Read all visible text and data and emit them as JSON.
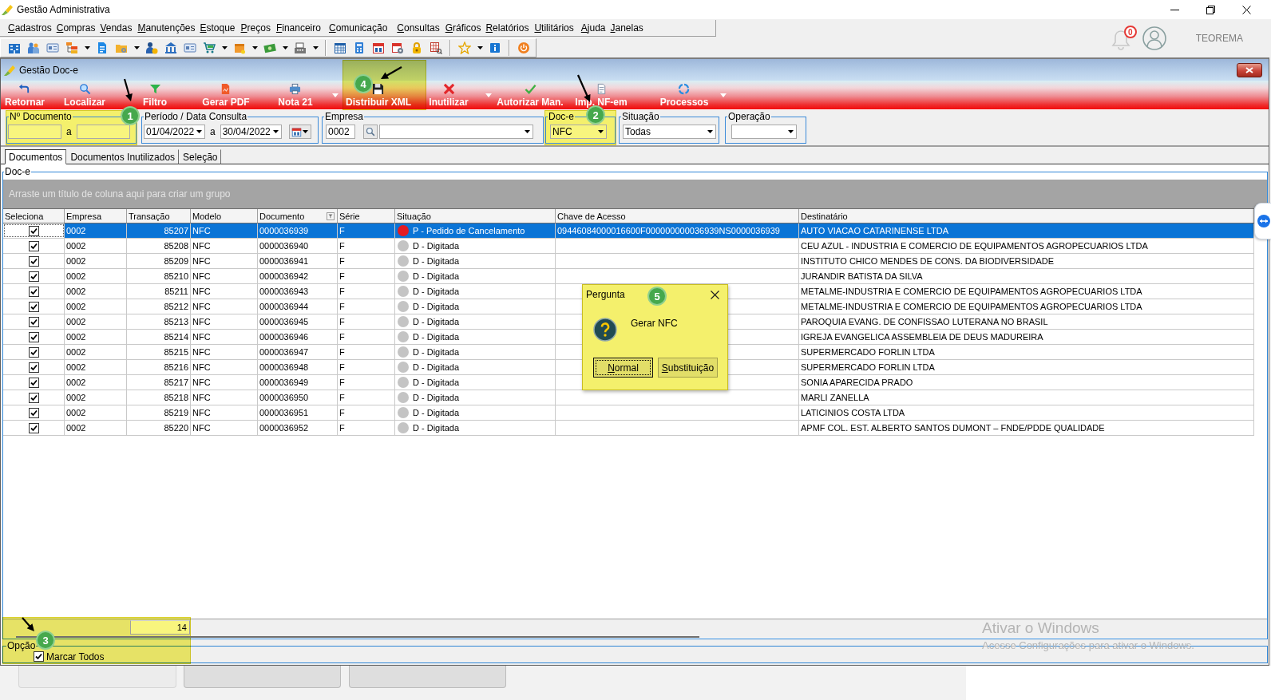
{
  "window": {
    "title": "Gestão Administrativa"
  },
  "menu": [
    "Cadastros",
    "Compras",
    "Vendas",
    "Manutenções",
    "Estoque",
    "Preços",
    "Financeiro",
    "Comunicação",
    "Consultas",
    "Gráficos",
    "Relatórios",
    "Utilitários",
    "Ajuda",
    "Janelas"
  ],
  "account": {
    "notifications": "0",
    "user": "TEOREMA"
  },
  "doc_window": {
    "title": "Gestão Doc-e",
    "actions": [
      {
        "label": "Retornar",
        "menu": false
      },
      {
        "label": "Localizar",
        "menu": false
      },
      {
        "label": "Filtro",
        "menu": false
      },
      {
        "label": "Gerar PDF",
        "menu": false
      },
      {
        "label": "Nota 21",
        "menu": true
      },
      {
        "label": "Distribuir XML",
        "menu": false
      },
      {
        "label": "Inutilizar",
        "menu": true
      },
      {
        "label": "Autorizar Man.",
        "menu": false
      },
      {
        "label": "Imp. NF-em",
        "menu": false
      },
      {
        "label": "Processos",
        "menu": true
      }
    ],
    "filters": {
      "document_number": {
        "label": "Nº Documento",
        "separator": "a"
      },
      "period": {
        "label": "Período / Data Consulta",
        "from": "01/04/2022",
        "separator": "a",
        "to": "30/04/2022"
      },
      "company": {
        "label": "Empresa",
        "code": "0002"
      },
      "doc_type": {
        "label": "Doc-e",
        "value": "NFC"
      },
      "status": {
        "label": "Situação",
        "value": "Todas"
      },
      "operation": {
        "label": "Operação"
      }
    },
    "tabs": [
      {
        "label": "Documentos",
        "selected": true
      },
      {
        "label": "Documentos Inutilizados",
        "selected": false
      },
      {
        "label": "Seleção",
        "selected": false
      }
    ],
    "grid": {
      "title": "Doc-e",
      "group_hint": "Arraste um título de coluna aqui para criar um grupo",
      "columns": [
        {
          "label": "Seleciona",
          "filter_button": false
        },
        {
          "label": "Empresa",
          "filter_button": false
        },
        {
          "label": "Transação",
          "filter_button": false
        },
        {
          "label": "Modelo",
          "filter_button": false
        },
        {
          "label": "Documento",
          "filter_button": true
        },
        {
          "label": "Série",
          "filter_button": false
        },
        {
          "label": "Situação",
          "filter_button": false
        },
        {
          "label": "Chave de Acesso",
          "filter_button": false
        },
        {
          "label": "Destinatário",
          "filter_button": false
        }
      ],
      "rows": [
        {
          "selected": true,
          "checked": true,
          "company": "0002",
          "transaction": "85207",
          "model": "NFC",
          "document": "0000036939",
          "series": "F",
          "color": "#e31b23",
          "status": "P - Pedido de Cancelamento",
          "access_key": "09446084000016600F000000000036939NS0000036939",
          "recipient": "AUTO VIACAO CATARINENSE LTDA"
        },
        {
          "selected": false,
          "checked": true,
          "company": "0002",
          "transaction": "85208",
          "model": "NFC",
          "document": "0000036940",
          "series": "F",
          "color": "#c4c4c4",
          "status": "D - Digitada",
          "recipient": "CEU AZUL - INDUSTRIA E COMERCIO DE EQUIPAMENTOS AGROPECUARIOS LTDA"
        },
        {
          "selected": false,
          "checked": true,
          "company": "0002",
          "transaction": "85209",
          "model": "NFC",
          "document": "0000036941",
          "series": "F",
          "color": "#c4c4c4",
          "status": "D - Digitada",
          "recipient": "INSTITUTO CHICO MENDES DE CONS. DA BIODIVERSIDADE"
        },
        {
          "selected": false,
          "checked": true,
          "company": "0002",
          "transaction": "85210",
          "model": "NFC",
          "document": "0000036942",
          "series": "F",
          "color": "#c4c4c4",
          "status": "D - Digitada",
          "recipient": "JURANDIR BATISTA DA SILVA"
        },
        {
          "selected": false,
          "checked": true,
          "company": "0002",
          "transaction": "85211",
          "model": "NFC",
          "document": "0000036943",
          "series": "F",
          "color": "#c4c4c4",
          "status": "D - Digitada",
          "recipient": "METALME-INDUSTRIA E COMERCIO DE EQUIPAMENTOS AGROPECUARIOS LTDA"
        },
        {
          "selected": false,
          "checked": true,
          "company": "0002",
          "transaction": "85212",
          "model": "NFC",
          "document": "0000036944",
          "series": "F",
          "color": "#c4c4c4",
          "status": "D - Digitada",
          "recipient": "METALME-INDUSTRIA E COMERCIO DE EQUIPAMENTOS AGROPECUARIOS LTDA"
        },
        {
          "selected": false,
          "checked": true,
          "company": "0002",
          "transaction": "85213",
          "model": "NFC",
          "document": "0000036945",
          "series": "F",
          "color": "#c4c4c4",
          "status": "D - Digitada",
          "recipient": "PAROQUIA EVANG. DE CONFISSAO LUTERANA NO BRASIL"
        },
        {
          "selected": false,
          "checked": true,
          "company": "0002",
          "transaction": "85214",
          "model": "NFC",
          "document": "0000036946",
          "series": "F",
          "color": "#c4c4c4",
          "status": "D - Digitada",
          "recipient": "IGREJA EVANGELICA ASSEMBLEIA DE DEUS MADUREIRA"
        },
        {
          "selected": false,
          "checked": true,
          "company": "0002",
          "transaction": "85215",
          "model": "NFC",
          "document": "0000036947",
          "series": "F",
          "color": "#c4c4c4",
          "status": "D - Digitada",
          "recipient": "SUPERMERCADO FORLIN LTDA"
        },
        {
          "selected": false,
          "checked": true,
          "company": "0002",
          "transaction": "85216",
          "model": "NFC",
          "document": "0000036948",
          "series": "F",
          "color": "#c4c4c4",
          "status": "D - Digitada",
          "recipient": "SUPERMERCADO FORLIN LTDA"
        },
        {
          "selected": false,
          "checked": true,
          "company": "0002",
          "transaction": "85217",
          "model": "NFC",
          "document": "0000036949",
          "series": "F",
          "color": "#c4c4c4",
          "status": "D - Digitada",
          "recipient": "SONIA APARECIDA PRADO"
        },
        {
          "selected": false,
          "checked": true,
          "company": "0002",
          "transaction": "85218",
          "model": "NFC",
          "document": "0000036950",
          "series": "F",
          "color": "#c4c4c4",
          "status": "D - Digitada",
          "recipient": "MARLI ZANELLA"
        },
        {
          "selected": false,
          "checked": true,
          "company": "0002",
          "transaction": "85219",
          "model": "NFC",
          "document": "0000036951",
          "series": "F",
          "color": "#c4c4c4",
          "status": "D - Digitada",
          "recipient": "LATICINIOS COSTA LTDA"
        },
        {
          "selected": false,
          "checked": true,
          "company": "0002",
          "transaction": "85220",
          "model": "NFC",
          "document": "0000036952",
          "series": "F",
          "color": "#c4c4c4",
          "status": "D - Digitada",
          "recipient": "APMF COL. EST. ALBERTO SANTOS DUMONT – FNDE/PDDE QUALIDADE"
        }
      ],
      "count": "14"
    },
    "options": {
      "title": "Opção",
      "mark_all": {
        "label": "Marcar Todos",
        "checked": true
      }
    }
  },
  "dialog": {
    "title": "Pergunta",
    "message": "Gerar NFC",
    "buttons": [
      {
        "label": "Normal",
        "focused": true
      },
      {
        "label": "Substituição",
        "focused": false
      }
    ]
  },
  "annotations": [
    {
      "number": "1"
    },
    {
      "number": "2"
    },
    {
      "number": "3"
    },
    {
      "number": "4"
    },
    {
      "number": "5"
    }
  ],
  "activation_notice": {
    "title": "Ativar o Windows",
    "text": "Acesse Configurações para ativar o Windows."
  },
  "background_buttons": [
    {
      "disabled": true
    },
    {
      "disabled": false
    },
    {
      "disabled": false
    }
  ]
}
